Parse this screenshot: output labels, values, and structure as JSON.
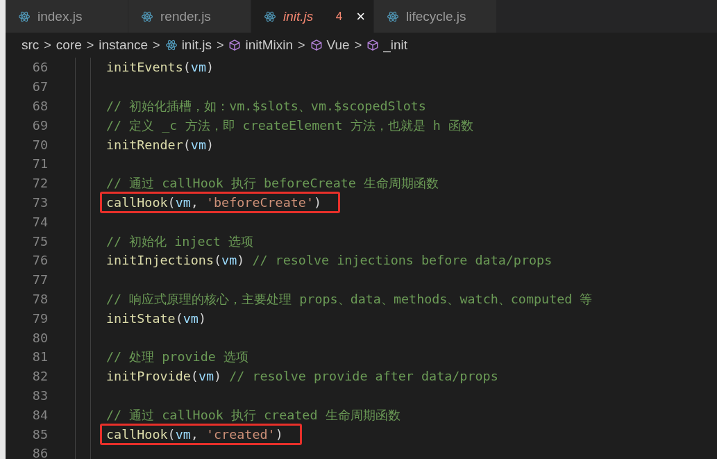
{
  "tabs": [
    {
      "label": "index.js",
      "selected": false
    },
    {
      "label": "render.js",
      "selected": false
    },
    {
      "label": "init.js",
      "selected": true,
      "problems": "4",
      "close": "×"
    },
    {
      "label": "lifecycle.js",
      "selected": false
    }
  ],
  "breadcrumbs": [
    {
      "kind": "folder",
      "label": "src"
    },
    {
      "kind": "folder",
      "label": "core"
    },
    {
      "kind": "folder",
      "label": "instance"
    },
    {
      "kind": "file",
      "label": "init.js"
    },
    {
      "kind": "symbol",
      "label": "initMixin"
    },
    {
      "kind": "symbol",
      "label": "Vue"
    },
    {
      "kind": "symbol",
      "label": "_init"
    }
  ],
  "separator": ">",
  "lines": [
    {
      "number": "66",
      "highlighted": false,
      "tokens": [
        {
          "kind": "fn",
          "text": "initEvents"
        },
        {
          "kind": "punc",
          "text": "("
        },
        {
          "kind": "var",
          "text": "vm"
        },
        {
          "kind": "punc",
          "text": ")"
        }
      ]
    },
    {
      "number": "67"
    },
    {
      "number": "68",
      "highlighted": false,
      "tokens": [
        {
          "kind": "comment",
          "text": "// 初始化插槽，如：vm.$slots、vm.$scopedSlots"
        }
      ]
    },
    {
      "number": "69",
      "highlighted": false,
      "tokens": [
        {
          "kind": "comment",
          "text": "// 定义 _c 方法，即 createElement 方法，也就是 h 函数"
        }
      ]
    },
    {
      "number": "70",
      "highlighted": false,
      "tokens": [
        {
          "kind": "fn",
          "text": "initRender"
        },
        {
          "kind": "punc",
          "text": "("
        },
        {
          "kind": "var",
          "text": "vm"
        },
        {
          "kind": "punc",
          "text": ")"
        }
      ]
    },
    {
      "number": "71"
    },
    {
      "number": "72",
      "highlighted": false,
      "tokens": [
        {
          "kind": "comment",
          "text": "// 通过 callHook 执行 beforeCreate 生命周期函数"
        }
      ]
    },
    {
      "number": "73",
      "highlighted": true,
      "tokens": [
        {
          "kind": "fn",
          "text": "callHook"
        },
        {
          "kind": "punc",
          "text": "("
        },
        {
          "kind": "var",
          "text": "vm"
        },
        {
          "kind": "punc",
          "text": ", "
        },
        {
          "kind": "string",
          "text": "'beforeCreate'"
        },
        {
          "kind": "punc",
          "text": ")"
        }
      ]
    },
    {
      "number": "74"
    },
    {
      "number": "75",
      "highlighted": false,
      "tokens": [
        {
          "kind": "comment",
          "text": "// 初始化 inject 选项"
        }
      ]
    },
    {
      "number": "76",
      "highlighted": false,
      "tokens": [
        {
          "kind": "fn",
          "text": "initInjections"
        },
        {
          "kind": "punc",
          "text": "("
        },
        {
          "kind": "var",
          "text": "vm"
        },
        {
          "kind": "punc",
          "text": ") "
        },
        {
          "kind": "comment",
          "text": "// resolve injections before data/props"
        }
      ]
    },
    {
      "number": "77"
    },
    {
      "number": "78",
      "highlighted": false,
      "tokens": [
        {
          "kind": "comment",
          "text": "// 响应式原理的核心，主要处理 props、data、methods、watch、computed 等"
        }
      ]
    },
    {
      "number": "79",
      "highlighted": false,
      "tokens": [
        {
          "kind": "fn",
          "text": "initState"
        },
        {
          "kind": "punc",
          "text": "("
        },
        {
          "kind": "var",
          "text": "vm"
        },
        {
          "kind": "punc",
          "text": ")"
        }
      ]
    },
    {
      "number": "80"
    },
    {
      "number": "81",
      "highlighted": false,
      "tokens": [
        {
          "kind": "comment",
          "text": "// 处理 provide 选项"
        }
      ]
    },
    {
      "number": "82",
      "highlighted": false,
      "tokens": [
        {
          "kind": "fn",
          "text": "initProvide"
        },
        {
          "kind": "punc",
          "text": "("
        },
        {
          "kind": "var",
          "text": "vm"
        },
        {
          "kind": "punc",
          "text": ") "
        },
        {
          "kind": "comment",
          "text": "// resolve provide after data/props"
        }
      ]
    },
    {
      "number": "83"
    },
    {
      "number": "84",
      "highlighted": false,
      "tokens": [
        {
          "kind": "comment",
          "text": "// 通过 callHook 执行 created 生命周期函数"
        }
      ]
    },
    {
      "number": "85",
      "highlighted": true,
      "tokens": [
        {
          "kind": "fn",
          "text": "callHook"
        },
        {
          "kind": "punc",
          "text": "("
        },
        {
          "kind": "var",
          "text": "vm"
        },
        {
          "kind": "punc",
          "text": ", "
        },
        {
          "kind": "string",
          "text": "'created'"
        },
        {
          "kind": "punc",
          "text": ")"
        }
      ]
    },
    {
      "number": "86"
    }
  ]
}
